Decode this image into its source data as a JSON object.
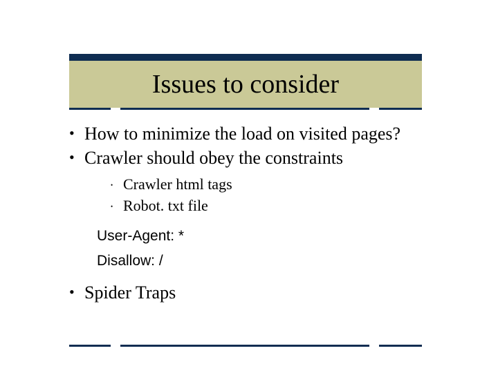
{
  "title": "Issues to consider",
  "bullets": {
    "b1": "How to minimize the load on visited pages?",
    "b2": "Crawler should obey the constraints",
    "sub1": "Crawler html tags",
    "sub2": "Robot. txt file",
    "code1": "User-Agent: *",
    "code2": "Disallow: /",
    "b3": "Spider Traps"
  }
}
